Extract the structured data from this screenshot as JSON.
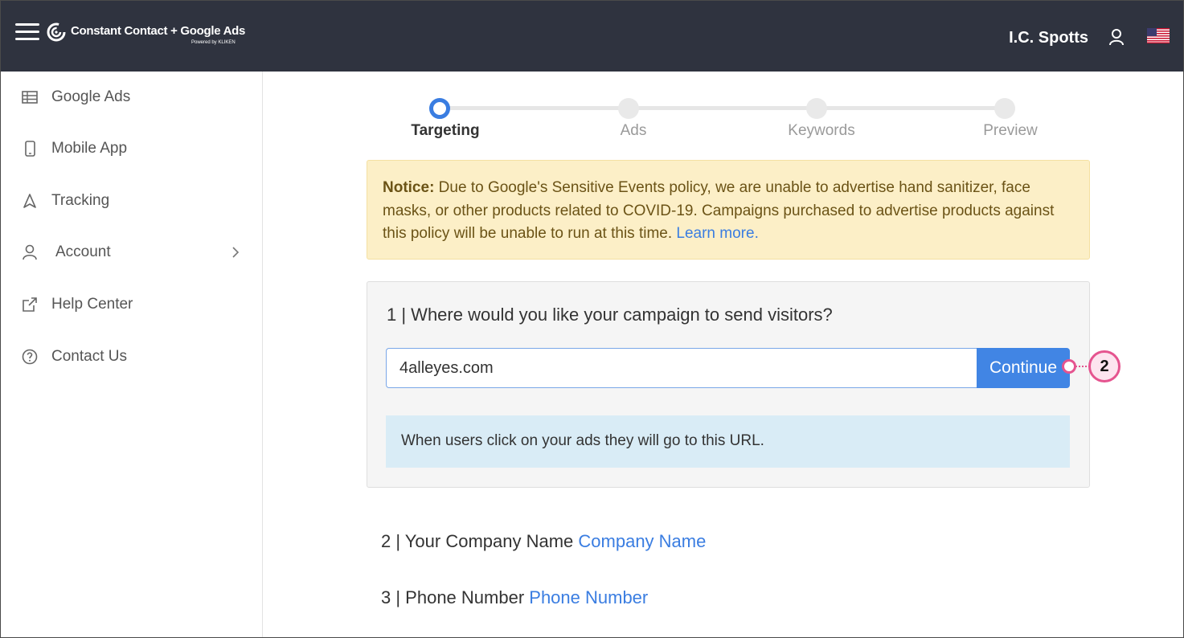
{
  "header": {
    "logo_text": "Constant Contact + Google Ads",
    "logo_subtext": "Powered by KLIKEN",
    "username": "I.C. Spotts",
    "icons": [
      "menu-icon",
      "user-icon",
      "us-flag-icon"
    ]
  },
  "sidebar": {
    "items": [
      {
        "label": "Google Ads",
        "icon": "table-icon"
      },
      {
        "label": "Mobile App",
        "icon": "mobile-icon"
      },
      {
        "label": "Tracking",
        "icon": "navigation-arrow-icon"
      },
      {
        "label": "Account",
        "icon": "user-icon",
        "has_chevron": true
      },
      {
        "label": "Help Center",
        "icon": "external-link-icon"
      },
      {
        "label": "Contact Us",
        "icon": "question-circle-icon"
      }
    ]
  },
  "stepper": {
    "steps": [
      "Targeting",
      "Ads",
      "Keywords",
      "Preview"
    ],
    "active_step": "Targeting"
  },
  "notice": {
    "label": "Notice:",
    "text": " Due to Google's Sensitive Events policy, we are unable to advertise hand sanitizer, face masks, or other products related to COVID-19. Campaigns purchased to advertise products against this policy will be unable to run at this time. ",
    "link": "Learn more."
  },
  "question1": {
    "title": "1 | Where would you like your campaign to send visitors?",
    "url_value": "4alleyes.com",
    "button_label": "Continue",
    "info": "When users click on your ads they will go to this URL."
  },
  "callout": {
    "number": "2"
  },
  "question2": {
    "prefix": "2 | Your Company Name ",
    "link": "Company Name"
  },
  "question3": {
    "prefix": "3 | Phone Number ",
    "link": "Phone Number"
  },
  "colors": {
    "topbar": "#2f333f",
    "accent_blue": "#4185e4",
    "notice_bg": "#fcefc7",
    "info_bg": "#d9ecf6",
    "callout_pink": "#e5548f"
  }
}
